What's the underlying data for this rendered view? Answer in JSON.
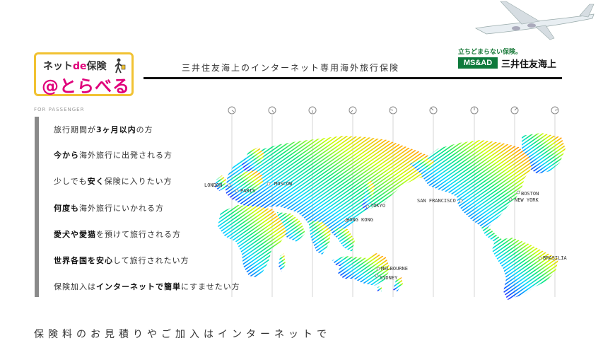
{
  "logo": {
    "net": "ネット",
    "de": "de",
    "hoken": "保険",
    "brand": "@とらべる"
  },
  "header": {
    "title": "三井住友海上のインターネット専用海外旅行保険",
    "tagline": "立ちどまらない保険。",
    "msad": "MS&AD",
    "company": "三井住友海上"
  },
  "for_passenger": "FOR PASSENGER",
  "items": [
    [
      "旅行期間が",
      "3ヶ月以内",
      "の方"
    ],
    [
      "",
      "今から",
      "海外旅行に出発される方"
    ],
    [
      "少しでも",
      "安く",
      "保険に入りたい方"
    ],
    [
      "",
      "何度も",
      "海外旅行にいかれる方"
    ],
    [
      "",
      "愛犬や愛猫",
      "を預けて旅行される方"
    ],
    [
      "",
      "世界各国を安心",
      "して旅行されたい方"
    ],
    [
      "保険加入は",
      "インターネットで簡単",
      "にすませたい方"
    ]
  ],
  "cities": [
    "LONDON",
    "PARIS",
    "MOSCOW",
    "TOKYO",
    "HONG KONG",
    "MELBOURNE",
    "SYDNEY",
    "SAN FRANCISCO",
    "BOSTON",
    "NEW YORK",
    "BRASILIA"
  ],
  "footer": "保険料のお見積りやご加入はインターネットで",
  "colors": {
    "accent_pink": "#e0007a",
    "logo_border": "#f1c232",
    "msad_green": "#0e7a3c"
  }
}
